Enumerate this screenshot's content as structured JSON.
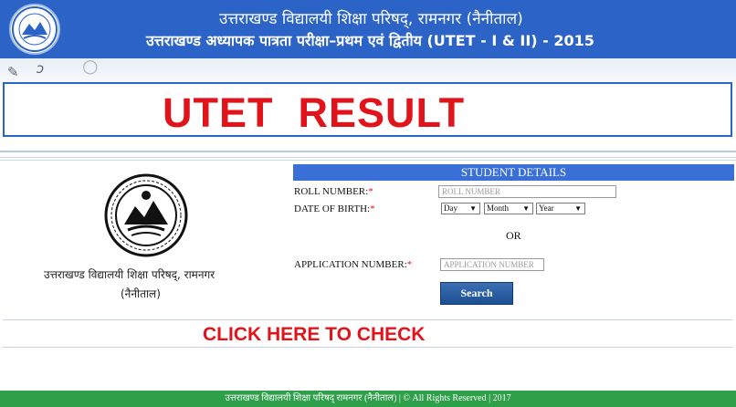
{
  "header": {
    "title_line1": "उत्तराखण्ड विद्यालयी शिक्षा परिषद्, रामनगर (नैनीताल)",
    "title_line2": "उत्तराखण्ड अध्यापक पात्रता परीक्षा–प्रथम एवं द्वितीय (UTET - I & II) - 2015"
  },
  "banner": {
    "text": "UTET  RESULT"
  },
  "left_panel": {
    "caption_line1": "उत्तराखण्ड विद्यालयी शिक्षा परिषद्, रामनगर",
    "caption_line2": "(नैनीताल)"
  },
  "form": {
    "header": "STUDENT DETAILS",
    "roll_label": "ROLL NUMBER:",
    "roll_placeholder": "ROLL NUMBER",
    "dob_label": "DATE OF BIRTH:",
    "day_value": "Day",
    "month_value": "Month",
    "year_value": "Year",
    "or_text": "OR",
    "app_label": "APPLICATION NUMBER:",
    "app_placeholder": "APPLICATION NUMBER",
    "required_mark": "*",
    "search_label": "Search"
  },
  "cta": {
    "text": "CLICK HERE TO CHECK"
  },
  "footer": {
    "text": "उत्तराखण्ड विद्यालयी शिक्षा परिषद् रामनगर (नैनीताल) | © All Rights Reserved | 2017"
  },
  "colors": {
    "header_blue": "#2b63c6",
    "accent_red": "#e2141b",
    "footer_green": "#2ea04a",
    "form_header_blue": "#3b6fd8"
  }
}
